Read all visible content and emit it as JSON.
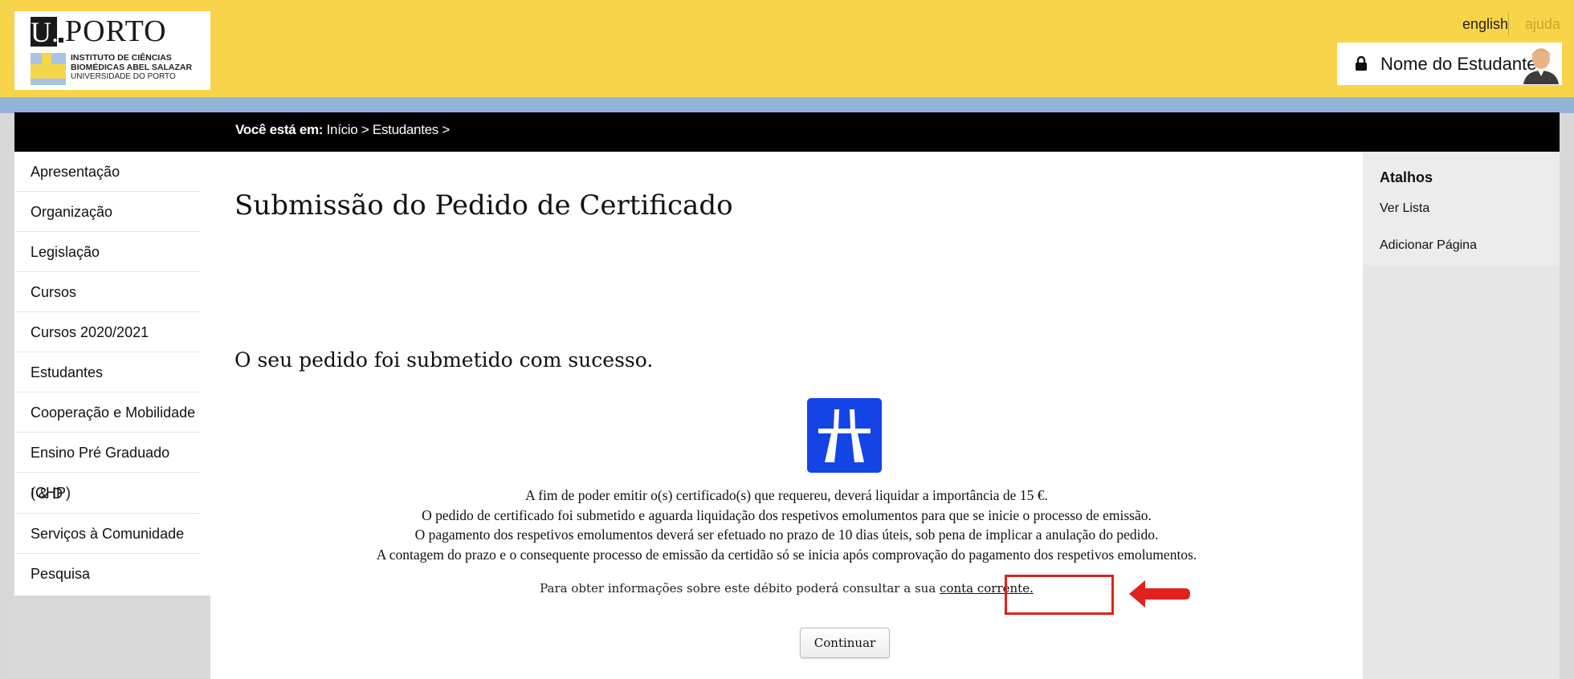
{
  "header": {
    "logo": {
      "u": "U.",
      "porto": "PORTO",
      "line1": "INSTITUTO DE CIÊNCIAS",
      "line2": "BIOMÉDICAS ABEL SALAZAR",
      "line3": "UNIVERSIDADE DO PORTO"
    },
    "lang_link": "english",
    "help_link": "ajuda",
    "user_name": "Nome do Estudante"
  },
  "breadcrumb": {
    "prefix": "Você está em:",
    "path": " Início > Estudantes >"
  },
  "sidebar": {
    "items": [
      {
        "label": "Apresentação"
      },
      {
        "label": "Organização"
      },
      {
        "label": "Legislação"
      },
      {
        "label": "Cursos"
      },
      {
        "label": "Cursos 2020/2021"
      },
      {
        "label": "Estudantes"
      },
      {
        "label": "Cooperação e Mobilidade"
      },
      {
        "label": "Ensino Pré Graduado (CHP)"
      },
      {
        "label": "I & D"
      },
      {
        "label": "Serviços à Comunidade"
      },
      {
        "label": "Pesquisa"
      }
    ]
  },
  "shortcuts": {
    "title": "Atalhos",
    "items": [
      {
        "label": "Ver Lista"
      },
      {
        "label": "Adicionar Página"
      }
    ]
  },
  "main": {
    "title": "Submissão do Pedido de Certificado",
    "success": "O seu pedido foi submetido com sucesso.",
    "messages": [
      "A fim de poder emitir o(s) certificado(s) que requereu, deverá liquidar a importância de 15 €.",
      "O pedido de certificado foi submetido e aguarda liquidação dos respetivos emolumentos para que se inicie o processo de emissão.",
      "O pagamento dos respetivos emolumentos deverá ser efetuado no prazo de 10 dias úteis, sob pena de implicar a anulação do pedido.",
      "A contagem do prazo e o consequente processo de emissão da certidão só se inicia após comprovação do pagamento dos respetivos emolumentos."
    ],
    "info_text": "Para obter informações sobre este débito poderá consultar a sua ",
    "info_link": "conta corrente.",
    "continue_button": "Continuar"
  },
  "colors": {
    "header": "#f7d44a",
    "blue_strip": "#95b3d6",
    "sign_blue": "#1444e6",
    "highlight_red": "#e0211c"
  },
  "icons": [
    "lock-icon",
    "avatar-icon",
    "motorway-sign-icon",
    "arrow-left-icon"
  ]
}
